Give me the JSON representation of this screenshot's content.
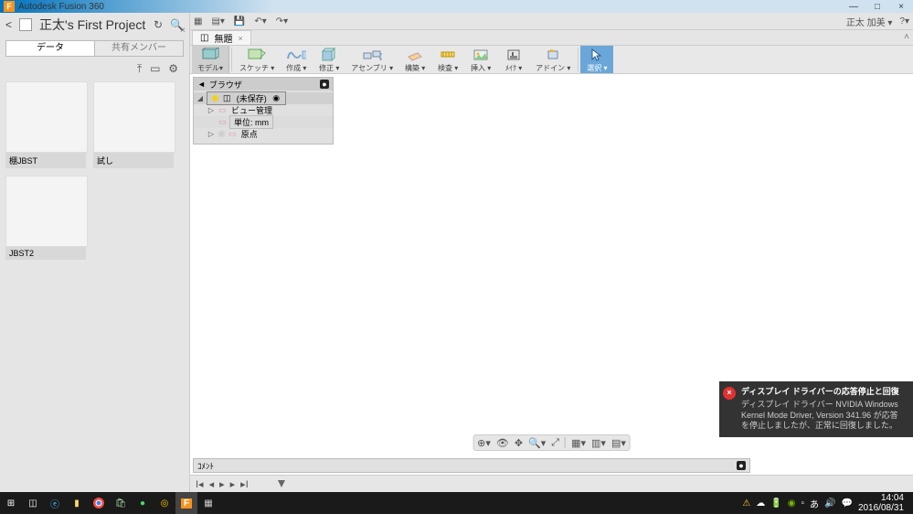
{
  "app": {
    "title": "Autodesk Fusion 360",
    "icon_letter": "F"
  },
  "window_buttons": {
    "min": "—",
    "max": "□",
    "close": "×"
  },
  "quickbar": {
    "user": "正太 加美",
    "help": "?"
  },
  "project": {
    "title": "正太's First Project",
    "back": "<"
  },
  "panel_tabs": {
    "data": "データ",
    "members": "共有メンバー"
  },
  "thumbs": [
    {
      "caption": "棚JBST"
    },
    {
      "caption": "試し"
    },
    {
      "caption": "JBST2"
    }
  ],
  "doc_tab": {
    "title": "無題"
  },
  "ribbon": {
    "model": "モデル▾",
    "sketch": "スケッチ ▾",
    "create": "作成 ▾",
    "modify": "修正 ▾",
    "assembly": "アセンブリ ▾",
    "construct": "構築 ▾",
    "inspect": "検査 ▾",
    "insert": "挿入 ▾",
    "make": "ﾒｲｸ ▾",
    "addin": "アドイン ▾",
    "select": "選択 ▾"
  },
  "browser": {
    "title": "ブラウザ",
    "root": "(未保存)",
    "view_mgmt": "ビュー管理",
    "units": "単位: mm",
    "origin": "原点"
  },
  "comment": {
    "label": "ｺﾒﾝﾄ"
  },
  "notification": {
    "title": "ディスプレイ ドライバーの応答停止と回復",
    "body": "ディスプレイ ドライバー NVIDIA Windows Kernel Mode Driver, Version 341.96  が応答を停止しましたが、正常に回復しました。"
  },
  "clock": {
    "time": "14:04",
    "date": "2016/08/31"
  }
}
